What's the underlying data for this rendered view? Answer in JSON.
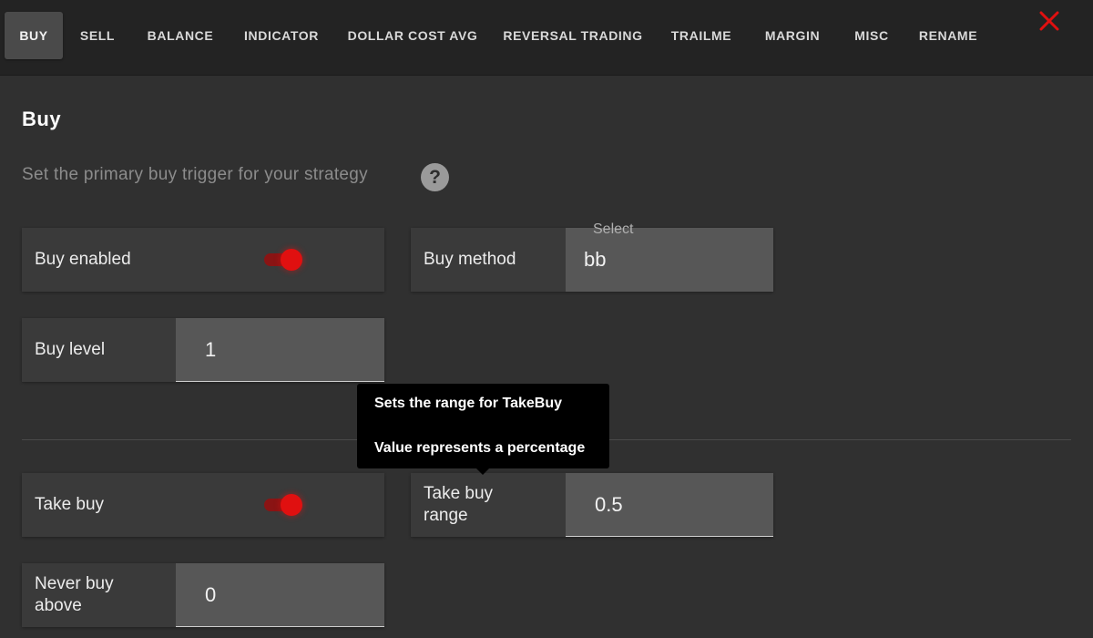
{
  "tabs": [
    {
      "label": "BUY",
      "active": true
    },
    {
      "label": "SELL"
    },
    {
      "label": "BALANCE"
    },
    {
      "label": "INDICATOR"
    },
    {
      "label": "DOLLAR COST AVG"
    },
    {
      "label": "REVERSAL TRADING"
    },
    {
      "label": "TRAILME"
    },
    {
      "label": "MARGIN"
    },
    {
      "label": "MISC"
    },
    {
      "label": "RENAME"
    }
  ],
  "close_icon": "close-x-icon",
  "accent_color": "#e01010",
  "section": {
    "title": "Buy",
    "subtitle": "Set the primary buy trigger for your strategy",
    "help_icon": "?"
  },
  "fields": {
    "buy_enabled": {
      "label": "Buy enabled",
      "on": true
    },
    "buy_method": {
      "label": "Buy method",
      "caption": "Select",
      "value": "bb"
    },
    "buy_level": {
      "label": "Buy level",
      "value": "1"
    },
    "take_buy": {
      "label": "Take buy",
      "on": true
    },
    "take_buy_range": {
      "label_line1": "Take buy",
      "label_line2": "range",
      "value": "0.5"
    },
    "never_buy_above": {
      "label_line1": "Never buy",
      "label_line2": "above",
      "value": "0"
    }
  },
  "tooltip": {
    "line1": "Sets the range for TakeBuy",
    "line2": "Value represents a percentage"
  }
}
